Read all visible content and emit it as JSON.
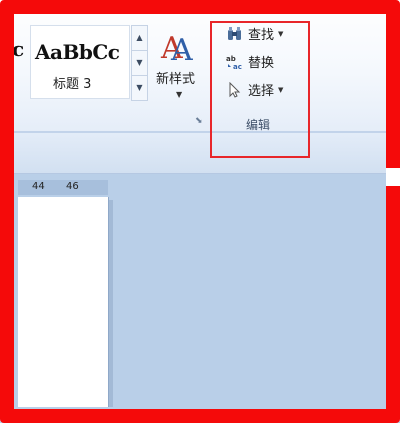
{
  "styles_gallery": {
    "sample_text": "AaBbCc",
    "previous_fragment": "c",
    "style_name": "标题 3",
    "scroll_up": "▲",
    "scroll_down": "▼",
    "more": "▼"
  },
  "new_style": {
    "icon_text": "A",
    "label": "新样式",
    "dropdown": "▼"
  },
  "editing": {
    "find_label": "查找",
    "replace_label": "替换",
    "select_label": "选择",
    "group_label": "编辑",
    "dropdown": "▼"
  },
  "ruler": {
    "ticks": [
      "44",
      "46"
    ]
  },
  "colors": {
    "highlight": "#e8262a",
    "frame": "#f50a0a",
    "ribbon_bg": "#f4f8fd",
    "workspace": "#b9cfe8"
  }
}
